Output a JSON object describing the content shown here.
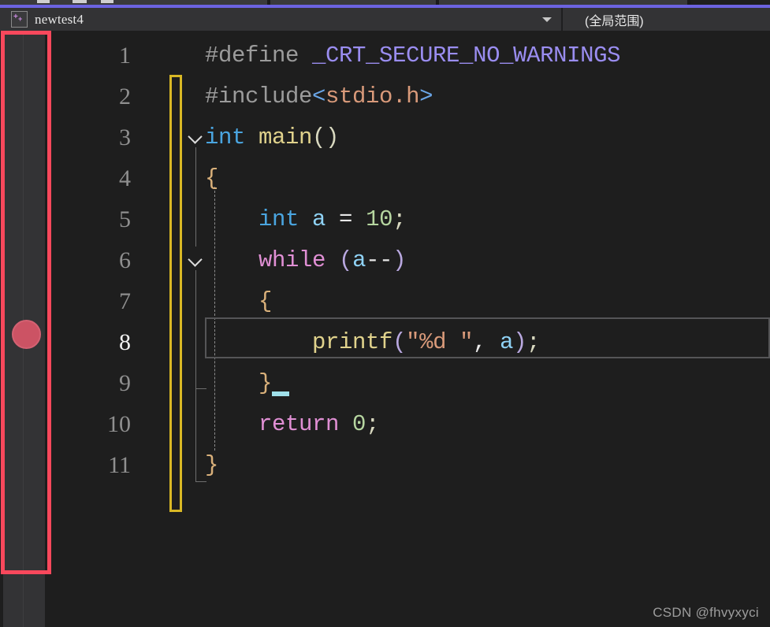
{
  "window": {
    "accent_color": "#6c63e0",
    "background": "#1e1e1e"
  },
  "navbar": {
    "file_icon": "cpp-file-icon",
    "file_name": "newtest4",
    "dropdown_icon": "chevron-down-icon",
    "scope_label": "(全局范围)"
  },
  "gutter": {
    "breakpoint": {
      "icon": "breakpoint-dot-icon",
      "line": 8,
      "color": "#cc5364"
    },
    "annotation_rect_color": "#f9485c",
    "change_bar_color": "#d9b825"
  },
  "editor": {
    "current_line": 8,
    "language": "C",
    "lines": [
      {
        "number": "1",
        "tokens": [
          {
            "text": "#define ",
            "cls": "t-pre"
          },
          {
            "text": "_CRT_SECURE_NO_WARNINGS",
            "cls": "t-macro"
          }
        ]
      },
      {
        "number": "2",
        "tokens": [
          {
            "text": "#include",
            "cls": "t-pre"
          },
          {
            "text": "<",
            "cls": "t-angle"
          },
          {
            "text": "stdio.h",
            "cls": "t-incl"
          },
          {
            "text": ">",
            "cls": "t-angle"
          }
        ]
      },
      {
        "number": "3",
        "tokens": [
          {
            "text": "int ",
            "cls": "t-kw"
          },
          {
            "text": "main",
            "cls": "t-fn"
          },
          {
            "text": "()",
            "cls": "t-punc"
          }
        ]
      },
      {
        "number": "4",
        "tokens": [
          {
            "text": "{",
            "cls": "t-brace"
          }
        ]
      },
      {
        "number": "5",
        "tokens": [
          {
            "text": "    ",
            "cls": "t-op"
          },
          {
            "text": "int ",
            "cls": "t-kw"
          },
          {
            "text": "a ",
            "cls": "t-var"
          },
          {
            "text": "= ",
            "cls": "t-op"
          },
          {
            "text": "10",
            "cls": "t-num"
          },
          {
            "text": ";",
            "cls": "t-punc"
          }
        ]
      },
      {
        "number": "6",
        "tokens": [
          {
            "text": "    ",
            "cls": "t-op"
          },
          {
            "text": "while ",
            "cls": "t-ctl"
          },
          {
            "text": "(",
            "cls": "t-paren"
          },
          {
            "text": "a",
            "cls": "t-var"
          },
          {
            "text": "--",
            "cls": "t-op"
          },
          {
            "text": ")",
            "cls": "t-paren"
          }
        ]
      },
      {
        "number": "7",
        "tokens": [
          {
            "text": "    ",
            "cls": "t-op"
          },
          {
            "text": "{",
            "cls": "t-brace"
          }
        ]
      },
      {
        "number": "8",
        "tokens": [
          {
            "text": "        ",
            "cls": "t-op"
          },
          {
            "text": "printf",
            "cls": "t-fn"
          },
          {
            "text": "(",
            "cls": "t-paren"
          },
          {
            "text": "\"%d \"",
            "cls": "t-str"
          },
          {
            "text": ", ",
            "cls": "t-op"
          },
          {
            "text": "a",
            "cls": "t-var"
          },
          {
            "text": ")",
            "cls": "t-paren"
          },
          {
            "text": ";",
            "cls": "t-punc"
          }
        ]
      },
      {
        "number": "9",
        "tokens": [
          {
            "text": "    ",
            "cls": "t-op"
          },
          {
            "text": "}",
            "cls": "t-brace"
          }
        ]
      },
      {
        "number": "10",
        "tokens": [
          {
            "text": "    ",
            "cls": "t-op"
          },
          {
            "text": "return ",
            "cls": "t-ctl"
          },
          {
            "text": "0",
            "cls": "t-num"
          },
          {
            "text": ";",
            "cls": "t-punc"
          }
        ]
      },
      {
        "number": "11",
        "tokens": [
          {
            "text": "}",
            "cls": "t-brace"
          }
        ]
      }
    ],
    "fold_markers": [
      {
        "line": 3,
        "icon": "chevron-down-icon"
      },
      {
        "line": 6,
        "icon": "chevron-down-icon"
      }
    ]
  },
  "watermark": {
    "text": "CSDN @fhvyxyci"
  }
}
